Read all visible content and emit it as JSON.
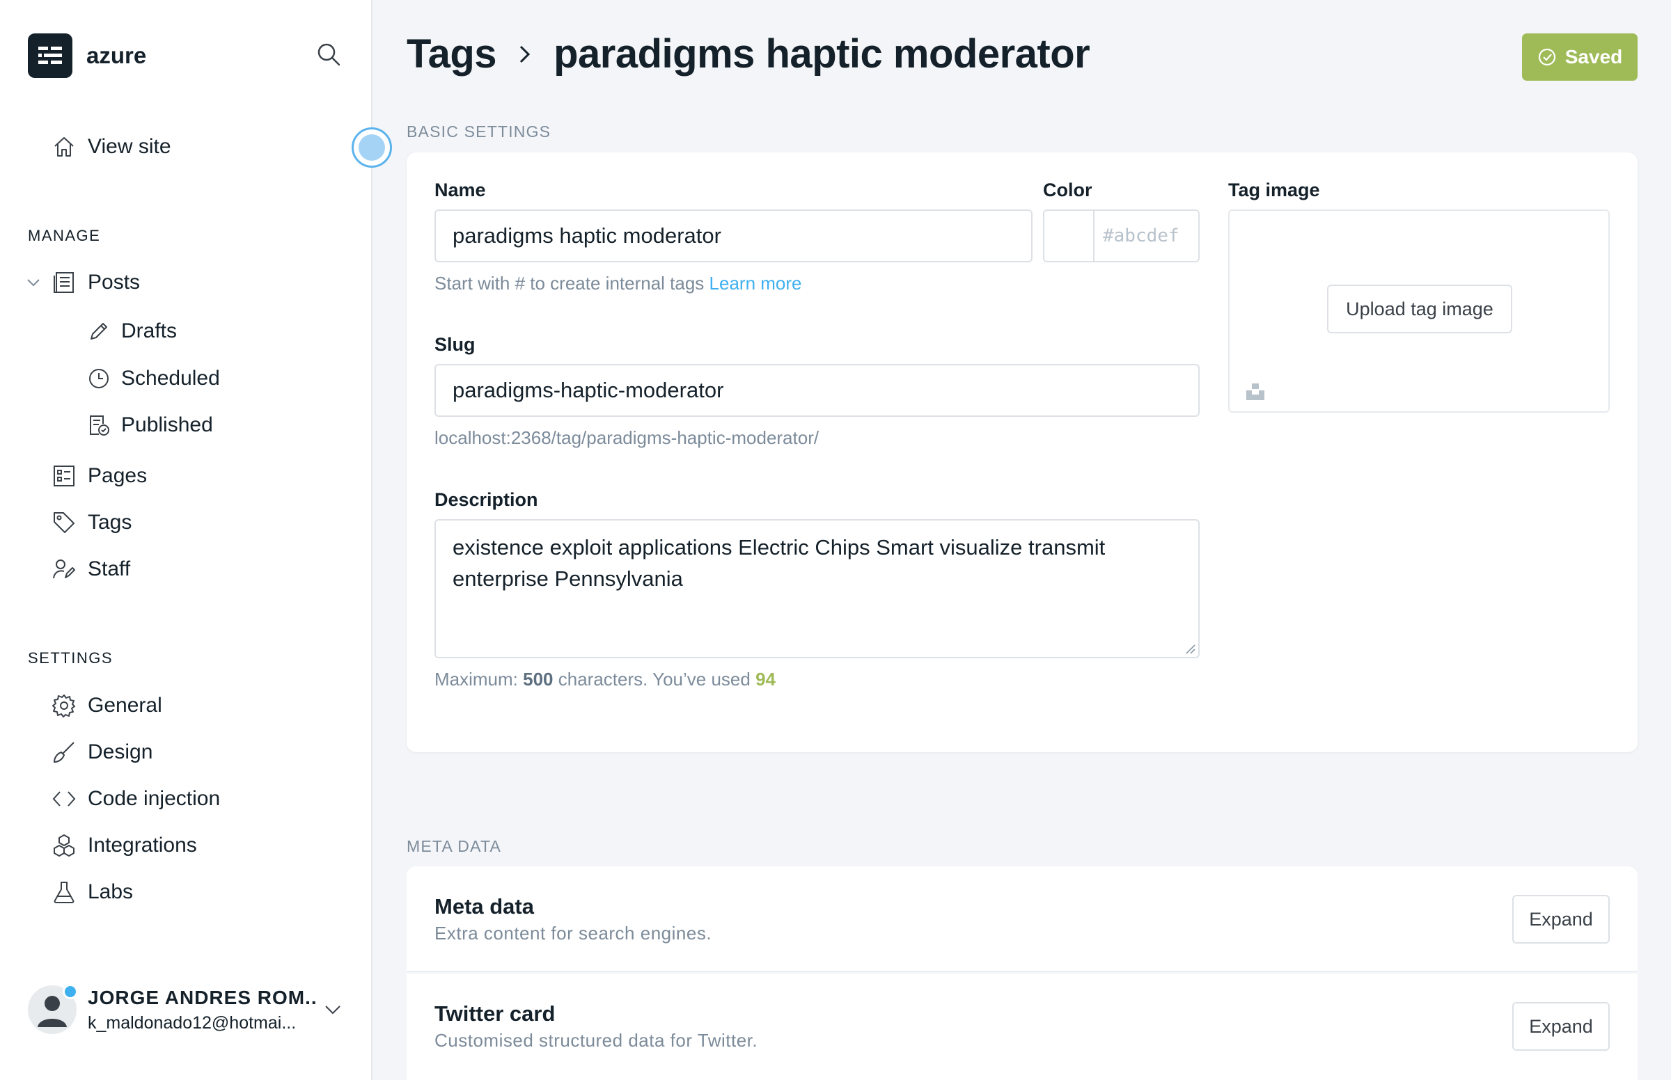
{
  "sidebar": {
    "brand": "azure",
    "view_site": "View site",
    "manage_label": "MANAGE",
    "posts": "Posts",
    "drafts": "Drafts",
    "scheduled": "Scheduled",
    "published": "Published",
    "pages": "Pages",
    "tags": "Tags",
    "staff": "Staff",
    "settings_label": "SETTINGS",
    "general": "General",
    "design": "Design",
    "code_injection": "Code injection",
    "integrations": "Integrations",
    "labs": "Labs",
    "user": {
      "name": "JORGE ANDRES ROM...",
      "email": "k_maldonado12@hotmai..."
    }
  },
  "header": {
    "breadcrumb_root": "Tags",
    "title": "paradigms haptic moderator",
    "saved_label": "Saved"
  },
  "basic": {
    "section_label": "BASIC SETTINGS",
    "name_label": "Name",
    "name_value": "paradigms haptic moderator",
    "name_hint": "Start with # to create internal tags",
    "learn_more": "Learn more",
    "color_label": "Color",
    "color_placeholder": "#abcdef",
    "slug_label": "Slug",
    "slug_value": "paradigms-haptic-moderator",
    "slug_url": "localhost:2368/tag/paradigms-haptic-moderator/",
    "description_label": "Description",
    "description_value": "existence exploit applications Electric Chips Smart visualize transmit enterprise Pennsylvania",
    "max_prefix": "Maximum:",
    "max_count": "500",
    "max_middle": "characters. You’ve used",
    "used_count": "94",
    "tag_image_label": "Tag image",
    "upload_label": "Upload tag image"
  },
  "meta": {
    "section_label": "META DATA",
    "rows": [
      {
        "title": "Meta data",
        "desc": "Extra content for search engines.",
        "button": "Expand"
      },
      {
        "title": "Twitter card",
        "desc": "Customised structured data for Twitter.",
        "button": "Expand"
      }
    ]
  },
  "colors": {
    "accent_green": "#9fbb58",
    "link_blue": "#3eb0ef",
    "text_dark": "#15212a"
  }
}
